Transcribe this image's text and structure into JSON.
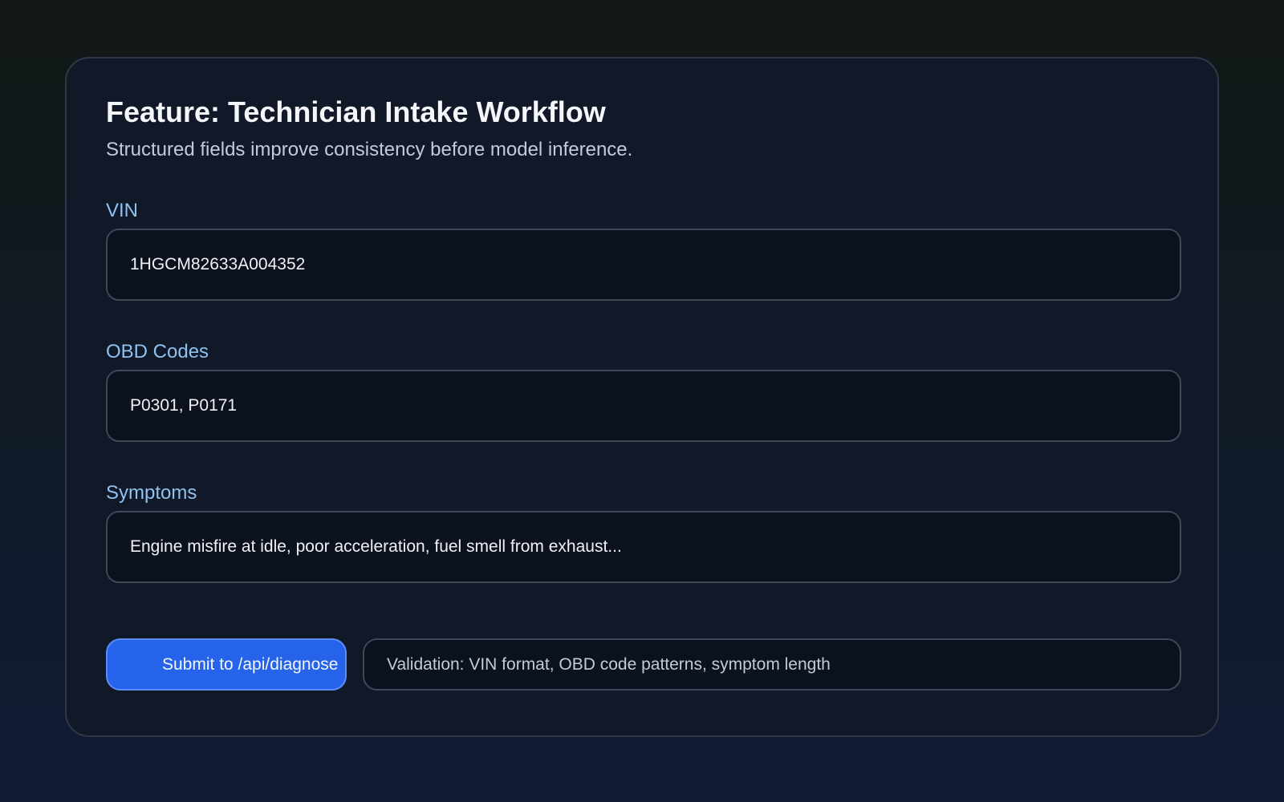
{
  "header": {
    "title": "Feature: Technician Intake Workflow",
    "subtitle": "Structured fields improve consistency before model inference."
  },
  "fields": [
    {
      "label": "VIN",
      "value": "1HGCM82633A004352"
    },
    {
      "label": "OBD Codes",
      "value": "P0301, P0171"
    },
    {
      "label": "Symptoms",
      "value": "Engine misfire at idle, poor acceleration, fuel smell from exhaust..."
    }
  ],
  "actions": {
    "submit_label": "Submit to /api/diagnose",
    "validation_text": "Validation: VIN format, OBD code patterns, symptom length"
  },
  "colors": {
    "accent": "#2563eb",
    "label": "#8ec2f0",
    "card_background": "#111828",
    "field_background": "#0b111d"
  }
}
